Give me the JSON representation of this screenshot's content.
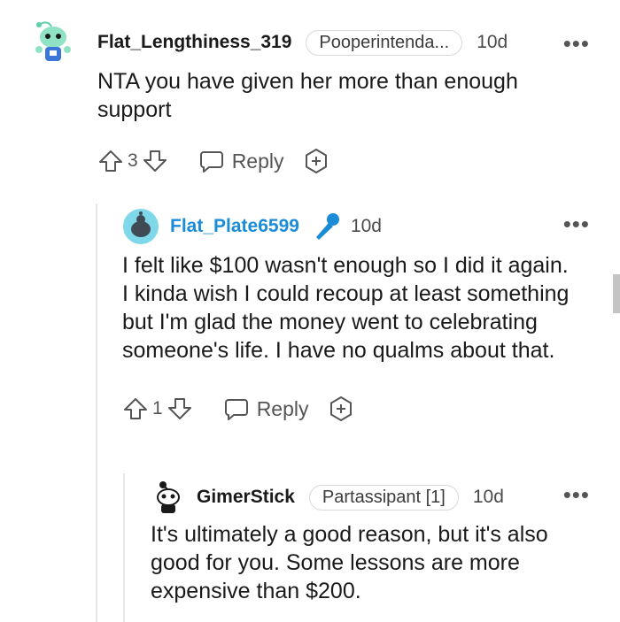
{
  "comments": [
    {
      "username": "Flat_Lengthiness_319",
      "flair": "Pooperintenda...",
      "time": "10d",
      "body": "NTA you have given her more than enough support",
      "votes": "3",
      "reply_label": "Reply",
      "avatar_icon": "snoo-avatar-icon"
    },
    {
      "username": "Flat_Plate6599",
      "badge_icon": "microphone-icon",
      "time": "10d",
      "body": "I felt like $100 wasn't enough so I did it again. I kinda wish I could recoup at least something but I'm glad the money went to celebrating someone's life. I have no qualms about that.",
      "votes": "1",
      "reply_label": "Reply",
      "avatar_icon": "snoo-avatar-icon",
      "username_color": "#1a8cd8"
    },
    {
      "username": "GimerStick",
      "flair": "Partassipant [1]",
      "time": "10d",
      "body": "It's ultimately a good reason, but it's also good for you. Some lessons are more expensive than $200.",
      "avatar_icon": "snoo-avatar-icon"
    }
  ],
  "more_label": "•••"
}
